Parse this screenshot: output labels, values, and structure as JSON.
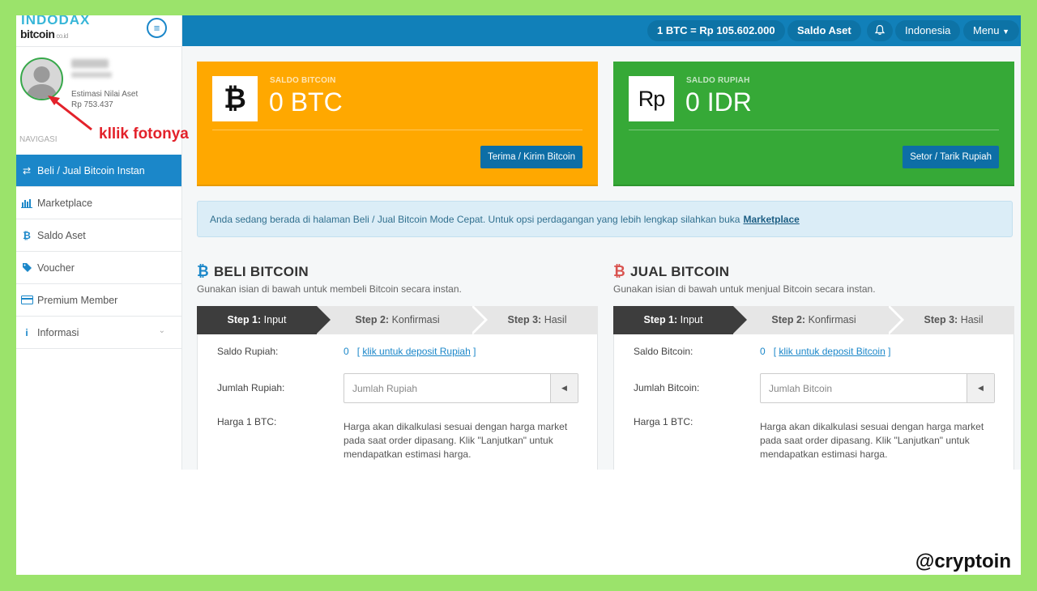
{
  "logo": {
    "top": "INDODAX",
    "bottom": "bitcoin",
    "sub": "co.id"
  },
  "sidebar": {
    "profile": {
      "estimate_label": "Estimasi Nilai Aset",
      "estimate_value": "Rp 753.437"
    },
    "nav_heading": "NAVIGASI",
    "items": [
      {
        "label": "Beli / Jual Bitcoin Instan",
        "icon": "exchange-icon"
      },
      {
        "label": "Marketplace",
        "icon": "bar-chart-icon"
      },
      {
        "label": "Saldo Aset",
        "icon": "bitcoin-icon"
      },
      {
        "label": "Voucher",
        "icon": "tag-icon"
      },
      {
        "label": "Premium Member",
        "icon": "credit-card-icon"
      },
      {
        "label": "Informasi",
        "icon": "info-icon"
      }
    ]
  },
  "topbar": {
    "price": "1 BTC = Rp 105.602.000",
    "saldo": "Saldo Aset",
    "language": "Indonesia",
    "menu": "Menu"
  },
  "cards": {
    "btc": {
      "icon_glyph": "₿",
      "label": "SALDO BITCOIN",
      "value": "0 BTC",
      "button": "Terima / Kirim Bitcoin"
    },
    "idr": {
      "icon_glyph": "Rp",
      "label": "SALDO RUPIAH",
      "value": "0 IDR",
      "button": "Setor / Tarik Rupiah"
    }
  },
  "info": {
    "text": "Anda sedang berada di halaman Beli / Jual Bitcoin Mode Cepat. Untuk opsi perdagangan yang lebih lengkap silahkan buka",
    "link": "Marketplace"
  },
  "buy": {
    "title": "BELI BITCOIN",
    "subtitle": "Gunakan isian di bawah untuk membeli Bitcoin secara instan.",
    "steps": [
      {
        "num": "Step 1:",
        "name": "Input"
      },
      {
        "num": "Step 2:",
        "name": "Konfirmasi"
      },
      {
        "num": "Step 3:",
        "name": "Hasil"
      }
    ],
    "balance_label": "Saldo Rupiah:",
    "balance_value": "0",
    "balance_link": "klik untuk deposit Rupiah",
    "amount_label": "Jumlah Rupiah:",
    "amount_placeholder": "Jumlah Rupiah",
    "price_label": "Harga 1 BTC:",
    "price_note": "Harga akan dikalkulasi sesuai dengan harga market pada saat order dipasang. Klik \"Lanjutkan\" untuk mendapatkan estimasi harga."
  },
  "sell": {
    "title": "JUAL BITCOIN",
    "subtitle": "Gunakan isian di bawah untuk menjual Bitcoin secara instan.",
    "steps": [
      {
        "num": "Step 1:",
        "name": "Input"
      },
      {
        "num": "Step 2:",
        "name": "Konfirmasi"
      },
      {
        "num": "Step 3:",
        "name": "Hasil"
      }
    ],
    "balance_label": "Saldo Bitcoin:",
    "balance_value": "0",
    "balance_link": "klik untuk deposit Bitcoin",
    "amount_label": "Jumlah Bitcoin:",
    "amount_placeholder": "Jumlah Bitcoin",
    "price_label": "Harga 1 BTC:",
    "price_note": "Harga akan dikalkulasi sesuai dengan harga market pada saat order dipasang. Klik \"Lanjutkan\" untuk mendapatkan estimasi harga."
  },
  "annotation": "kllik fotonya",
  "watermark": "@cryptoin",
  "colors": {
    "accent": "#1b87c9",
    "orange": "#ffa800",
    "green": "#36a937",
    "annotation": "#e3222b",
    "background": "#9be36b"
  }
}
